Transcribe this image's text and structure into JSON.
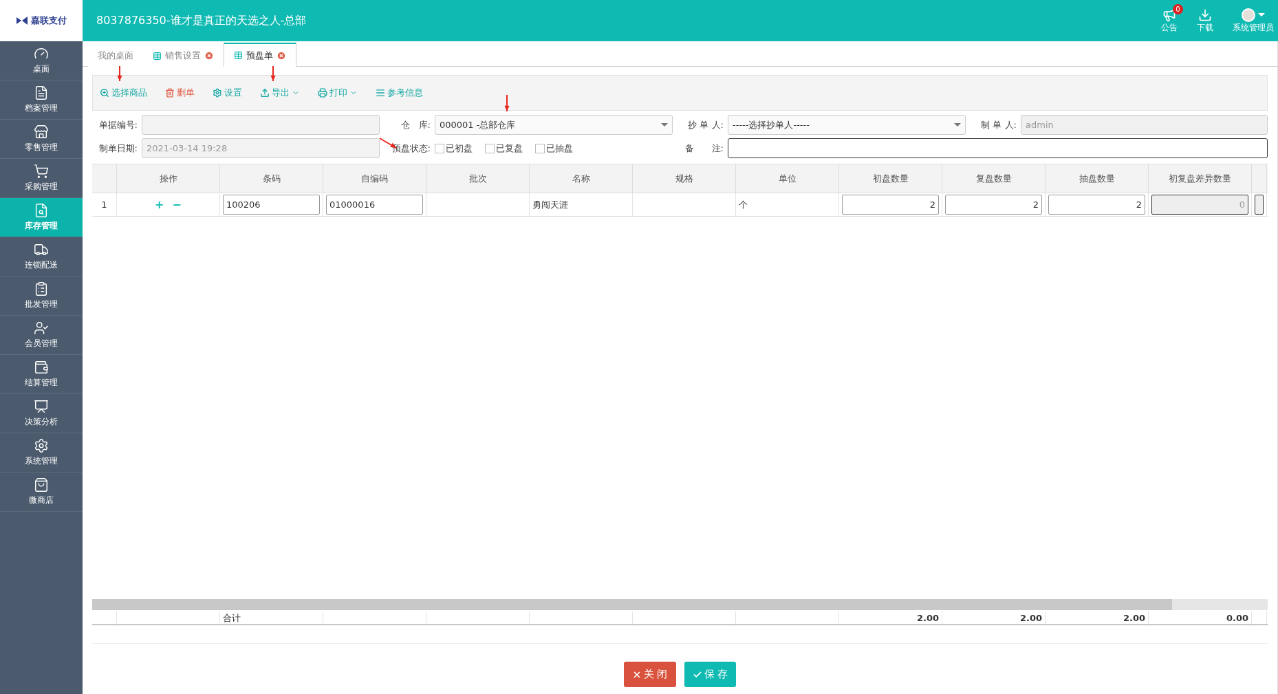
{
  "header": {
    "logo_text": "嘉联支付",
    "title": "8037876350-谁才是真正的天选之人-总部",
    "notice": {
      "label": "公告",
      "badge": "0"
    },
    "download": {
      "label": "下载"
    },
    "user": {
      "label": "系统管理员"
    }
  },
  "sidebar": {
    "items": [
      {
        "label": "桌面",
        "selected": false
      },
      {
        "label": "档案管理",
        "selected": false
      },
      {
        "label": "零售管理",
        "selected": false
      },
      {
        "label": "采购管理",
        "selected": false
      },
      {
        "label": "库存管理",
        "selected": true
      },
      {
        "label": "连锁配送",
        "selected": false
      },
      {
        "label": "批发管理",
        "selected": false
      },
      {
        "label": "会员管理",
        "selected": false
      },
      {
        "label": "结算管理",
        "selected": false
      },
      {
        "label": "决策分析",
        "selected": false
      },
      {
        "label": "系统管理",
        "selected": false
      },
      {
        "label": "微商店",
        "selected": false
      }
    ]
  },
  "tabs": [
    {
      "label": "我的桌面",
      "selected": false,
      "closable": false
    },
    {
      "label": "销售设置",
      "selected": false,
      "closable": true
    },
    {
      "label": "预盘单",
      "selected": true,
      "closable": true
    }
  ],
  "toolbar": [
    {
      "label": "选择商品",
      "color": "#17a9a4",
      "dropdown": false
    },
    {
      "label": "删单",
      "color": "#e0644f",
      "dropdown": false
    },
    {
      "label": "设置",
      "color": "#17a9a4",
      "dropdown": false
    },
    {
      "label": "导出",
      "color": "#17a9a4",
      "dropdown": true
    },
    {
      "label": "打印",
      "color": "#17a9a4",
      "dropdown": true
    },
    {
      "label": "参考信息",
      "color": "#17a9a4",
      "dropdown": false
    }
  ],
  "form": {
    "doc_no": {
      "label": "单据编号:"
    },
    "warehouse": {
      "label": "仓　库:",
      "value": "000001 -总部仓库"
    },
    "copier": {
      "label": "抄 单 人:",
      "value": "-----选择抄单人-----"
    },
    "maker": {
      "label": "制 单 人:",
      "value": "admin"
    },
    "date": {
      "label": "制单日期:",
      "value": "2021-03-14 19:28"
    },
    "status": {
      "label": "预盘状态:",
      "options": [
        {
          "label": "已初盘",
          "checked": false
        },
        {
          "label": "已复盘",
          "checked": false
        },
        {
          "label": "已抽盘",
          "checked": false
        }
      ]
    },
    "remark": {
      "label": "备　　注:"
    }
  },
  "table": {
    "columns": [
      "操作",
      "条码",
      "自编码",
      "批次",
      "名称",
      "规格",
      "单位",
      "初盘数量",
      "复盘数量",
      "抽盘数量",
      "初复盘差异数量"
    ],
    "rows": [
      {
        "index": "1",
        "ops": [
          "+",
          "−"
        ],
        "barcode": "100206",
        "code": "01000016",
        "name": "勇闯天涯",
        "unit": "个",
        "first": "2",
        "second": "2",
        "sample": "2",
        "diff": "0"
      }
    ],
    "footer": {
      "label": "合计",
      "totals": [
        "2.00",
        "2.00",
        "2.00",
        "0.00"
      ]
    }
  },
  "buttons": [
    {
      "label": "关 闭",
      "kind": "close"
    },
    {
      "label": "保 存",
      "kind": "save"
    }
  ]
}
